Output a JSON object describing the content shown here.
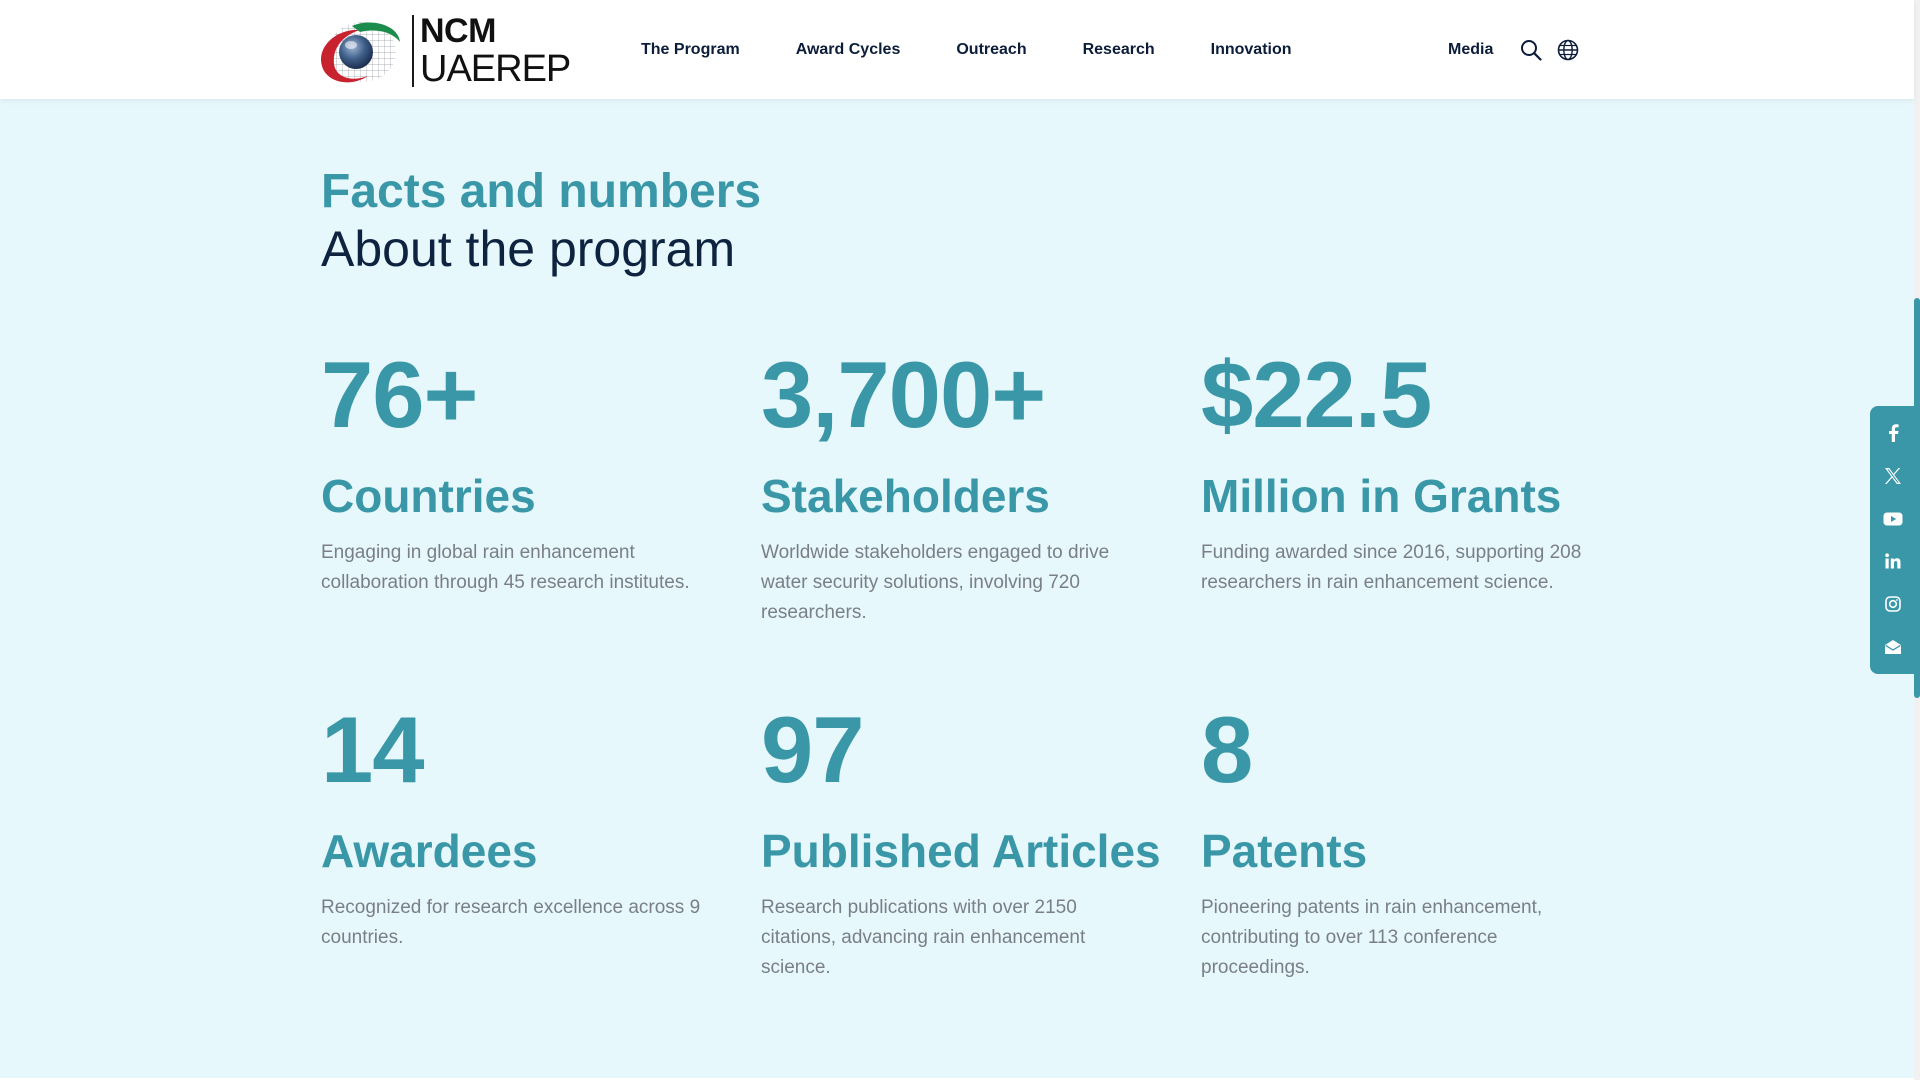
{
  "brand": {
    "top": "NCM",
    "bottom": "UAEREP"
  },
  "nav": {
    "items": [
      {
        "label": "The Program"
      },
      {
        "label": "Award Cycles"
      },
      {
        "label": "Outreach"
      },
      {
        "label": "Research"
      },
      {
        "label": "Innovation"
      }
    ],
    "media_label": "Media",
    "search_icon": "search-icon",
    "language_icon": "globe-icon"
  },
  "section": {
    "title_accent": "Facts and numbers",
    "title_main": "About the program"
  },
  "stats": [
    {
      "number": "76+",
      "label": "Countries",
      "desc": "Engaging in global rain enhancement collaboration through 45 research institutes."
    },
    {
      "number": "3,700+",
      "label": "Stakeholders",
      "desc": "Worldwide stakeholders engaged to drive water security solutions, involving 720 researchers."
    },
    {
      "number": "$22.5",
      "label": "Million in Grants",
      "desc": "Funding awarded since 2016, supporting 208 researchers in rain enhancement science."
    },
    {
      "number": "14",
      "label": "Awardees",
      "desc": "Recognized for research excellence across 9 countries."
    },
    {
      "number": "97",
      "label": "Published Articles",
      "desc": "Research publications with over 2150 citations, advancing rain enhancement science."
    },
    {
      "number": "8",
      "label": "Patents",
      "desc": "Pioneering patents in rain enhancement, contributing to over 113 conference proceedings."
    }
  ],
  "social": [
    "facebook-icon",
    "x-icon",
    "youtube-icon",
    "linkedin-icon",
    "instagram-icon",
    "email-icon"
  ],
  "colors": {
    "accent": "#3a97a8",
    "dark": "#0e2340",
    "background": "#e6f8fc",
    "text_muted": "#7a7f87"
  }
}
